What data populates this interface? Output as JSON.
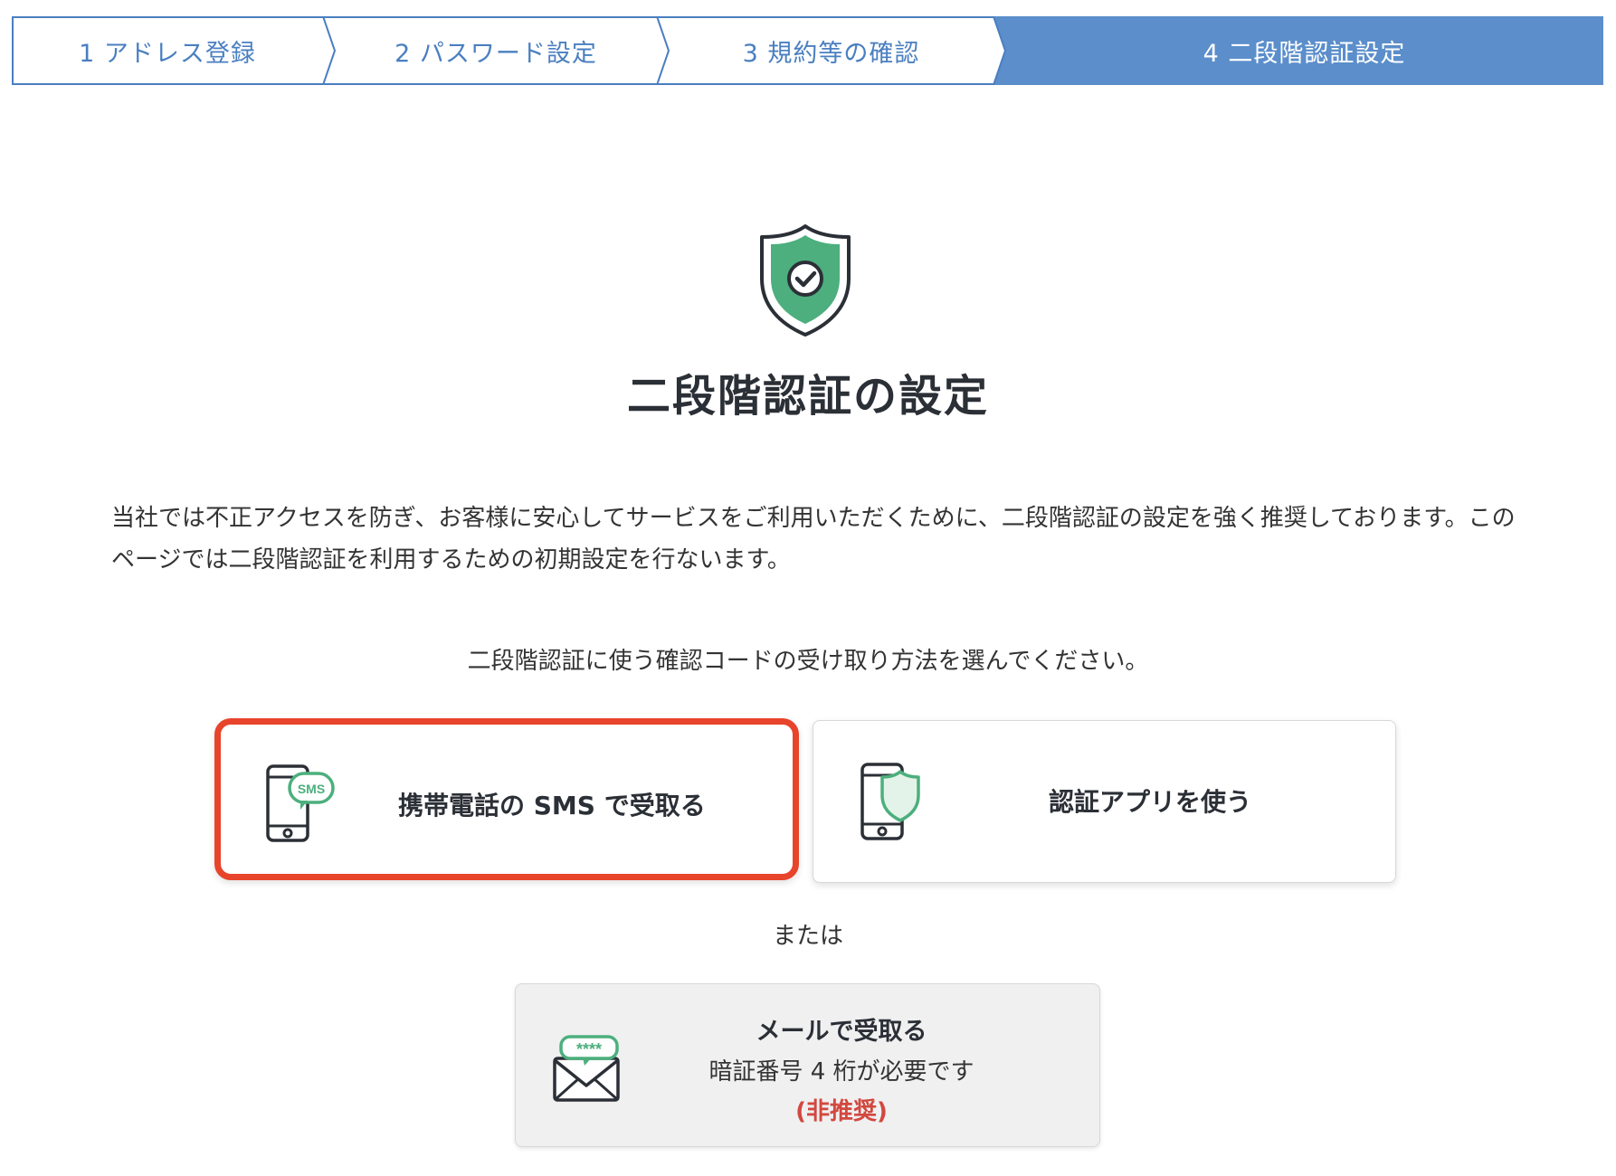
{
  "steps": [
    {
      "label": "1 アドレス登録",
      "active": false
    },
    {
      "label": "2 パスワード設定",
      "active": false
    },
    {
      "label": "3 規約等の確認",
      "active": false
    },
    {
      "label": "4 二段階認証設定",
      "active": true
    }
  ],
  "colors": {
    "step_border": "#4a7fc0",
    "step_active_bg": "#5b8ecb",
    "shield_green": "#4caf7d",
    "selected_border": "#e8442b",
    "warning": "#d2483f"
  },
  "page": {
    "title": "二段階認証の設定",
    "intro": "当社では不正アクセスを防ぎ、お客様に安心してサービスをご利用いただくために、二段階認証の設定を強く推奨しております。このページでは二段階認証を利用するための初期設定を行ないます。",
    "prompt": "二段階認証に使う確認コードの受け取り方法を選んでください。",
    "or_text": "または"
  },
  "options": {
    "sms": {
      "label": "携帯電話の SMS で受取る",
      "icon": "phone-sms-icon",
      "icon_text": "SMS",
      "selected": true
    },
    "app": {
      "label": "認証アプリを使う",
      "icon": "phone-shield-icon",
      "selected": false
    },
    "mail": {
      "title": "メールで受取る",
      "subtitle": "暗証番号 4 桁が必要です",
      "warning": "(非推奨)",
      "icon": "mail-code-icon",
      "icon_text": "****"
    }
  }
}
